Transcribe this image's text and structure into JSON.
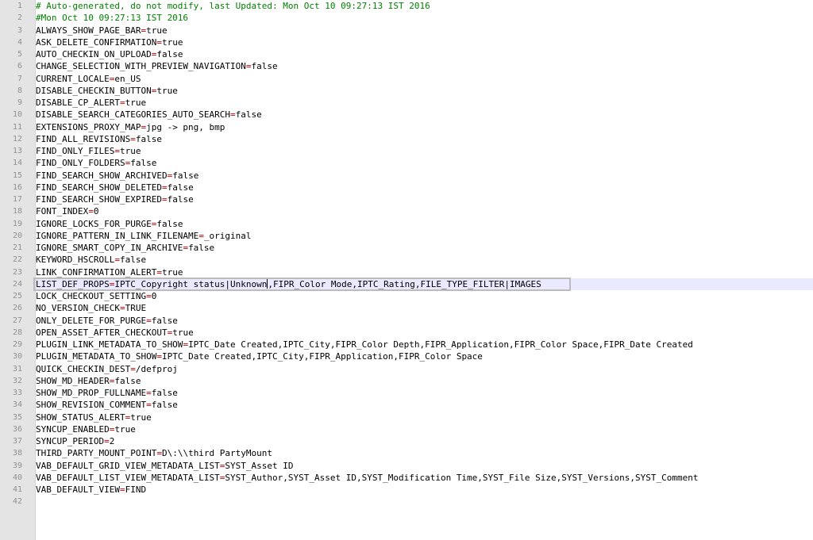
{
  "lines": [
    {
      "n": "1",
      "comment": "# Auto-generated, do not modify, last Updated: Mon Oct 10 09:27:13 IST 2016"
    },
    {
      "n": "2",
      "comment": "#Mon Oct 10 09:27:13 IST 2016"
    },
    {
      "n": "3",
      "key": "ALWAYS_SHOW_PAGE_BAR",
      "value": "true"
    },
    {
      "n": "4",
      "key": "ASK_DELETE_CONFIRMATION",
      "value": "true"
    },
    {
      "n": "5",
      "key": "AUTO_CHECKIN_ON_UPLOAD",
      "value": "false"
    },
    {
      "n": "6",
      "key": "CHANGE_SELECTION_WITH_PREVIEW_NAVIGATION",
      "value": "false"
    },
    {
      "n": "7",
      "key": "CURRENT_LOCALE",
      "value": "en_US"
    },
    {
      "n": "8",
      "key": "DISABLE_CHECKIN_BUTTON",
      "value": "true"
    },
    {
      "n": "9",
      "key": "DISABLE_CP_ALERT",
      "value": "true"
    },
    {
      "n": "10",
      "key": "DISABLE_SEARCH_CATEGORIES_AUTO_SEARCH",
      "value": "false"
    },
    {
      "n": "11",
      "key": "EXTENSIONS_PROXY_MAP",
      "value": "jpg -> png, bmp"
    },
    {
      "n": "12",
      "key": "FIND_ALL_REVISIONS",
      "value": "false"
    },
    {
      "n": "13",
      "key": "FIND_ONLY_FILES",
      "value": "true"
    },
    {
      "n": "14",
      "key": "FIND_ONLY_FOLDERS",
      "value": "false"
    },
    {
      "n": "15",
      "key": "FIND_SEARCH_SHOW_ARCHIVED",
      "value": "false"
    },
    {
      "n": "16",
      "key": "FIND_SEARCH_SHOW_DELETED",
      "value": "false"
    },
    {
      "n": "17",
      "key": "FIND_SEARCH_SHOW_EXPIRED",
      "value": "false"
    },
    {
      "n": "18",
      "key": "FONT_INDEX",
      "value": "0"
    },
    {
      "n": "19",
      "key": "IGNORE_LOCKS_FOR_PURGE",
      "value": "false"
    },
    {
      "n": "20",
      "key": "IGNORE_PATTERN_IN_LINK_FILENAME",
      "value": "_original"
    },
    {
      "n": "21",
      "key": "IGNORE_SMART_COPY_IN_ARCHIVE",
      "value": "false"
    },
    {
      "n": "22",
      "key": "KEYWORD_HSCROLL",
      "value": "false"
    },
    {
      "n": "23",
      "key": "LINK_CONFIRMATION_ALERT",
      "value": "true"
    },
    {
      "n": "24",
      "key": "LIST_DEF_PROPS",
      "value_before_caret": "IPTC_Copyright status|Unknown",
      "value_after_caret": ",FIPR_Color Mode,IPTC_Rating,FILE_TYPE_FILTER|IMAGES",
      "current": true
    },
    {
      "n": "25",
      "key": "LOCK_CHECKOUT_SETTING",
      "value": "0"
    },
    {
      "n": "26",
      "key": "NO_VERSION_CHECK",
      "value": "TRUE"
    },
    {
      "n": "27",
      "key": "ONLY_DELETE_FOR_PURGE",
      "value": "false"
    },
    {
      "n": "28",
      "key": "OPEN_ASSET_AFTER_CHECKOUT",
      "value": "true"
    },
    {
      "n": "29",
      "key": "PLUGIN_LINK_METADATA_TO_SHOW",
      "value": "IPTC_Date Created,IPTC_City,FIPR_Color Depth,FIPR_Application,FIPR_Color Space,FIPR_Date Created"
    },
    {
      "n": "30",
      "key": "PLUGIN_METADATA_TO_SHOW",
      "value": "IPTC_Date Created,IPTC_City,FIPR_Application,FIPR_Color Space"
    },
    {
      "n": "31",
      "key": "QUICK_CHECKIN_DEST",
      "value": "/defproj"
    },
    {
      "n": "32",
      "key": "SHOW_MD_HEADER",
      "value": "false"
    },
    {
      "n": "33",
      "key": "SHOW_MD_PROP_FULLNAME",
      "value": "false"
    },
    {
      "n": "34",
      "key": "SHOW_REVISION_COMMENT",
      "value": "false"
    },
    {
      "n": "35",
      "key": "SHOW_STATUS_ALERT",
      "value": "true"
    },
    {
      "n": "36",
      "key": "SYNCUP_ENABLED",
      "value": "true"
    },
    {
      "n": "37",
      "key": "SYNCUP_PERIOD",
      "value": "2"
    },
    {
      "n": "38",
      "key": "THIRD_PARTY_MOUNT_POINT",
      "value": "D\\:\\\\third PartyMount"
    },
    {
      "n": "39",
      "key": "VAB_DEFAULT_GRID_VIEW_METADATA_LIST",
      "value": "SYST_Asset ID"
    },
    {
      "n": "40",
      "key": "VAB_DEFAULT_LIST_VIEW_METADATA_LIST",
      "value": "SYST_Author,SYST_Asset ID,SYST_Modification Time,SYST_File Size,SYST_Versions,SYST_Comment"
    },
    {
      "n": "41",
      "key": "VAB_DEFAULT_VIEW",
      "value": "FIND"
    },
    {
      "n": "42"
    }
  ],
  "colors": {
    "comment": "#008000",
    "equals": "#d20000",
    "gutter": "#e4e4e4",
    "current_line": "#e9e9ff"
  }
}
